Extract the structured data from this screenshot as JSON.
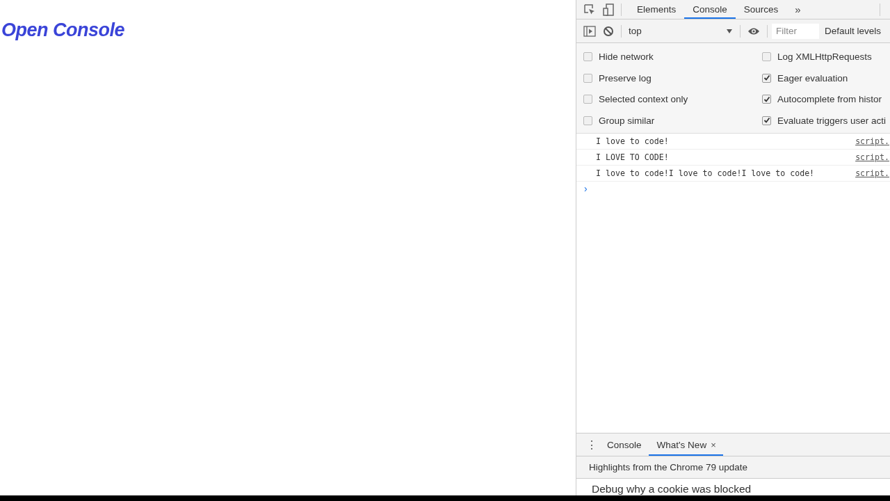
{
  "page": {
    "heading": "Open Console"
  },
  "devtools": {
    "tabs": [
      {
        "label": "Elements",
        "selected": false
      },
      {
        "label": "Console",
        "selected": true
      },
      {
        "label": "Sources",
        "selected": false
      }
    ],
    "more_tabs": "»",
    "context": "top",
    "filter": {
      "placeholder": "Filter"
    },
    "levels": "Default levels",
    "settings": [
      {
        "label": "Hide network",
        "checked": false
      },
      {
        "label": "Log XMLHttpRequests",
        "checked": false
      },
      {
        "label": "Preserve log",
        "checked": false
      },
      {
        "label": "Eager evaluation",
        "checked": true
      },
      {
        "label": "Selected context only",
        "checked": false
      },
      {
        "label": "Autocomplete from histor",
        "checked": true
      },
      {
        "label": "Group similar",
        "checked": false
      },
      {
        "label": "Evaluate triggers user acti",
        "checked": true
      }
    ],
    "messages": [
      {
        "text": "I love to code!",
        "source": "script."
      },
      {
        "text": "I LOVE TO CODE!",
        "source": "script."
      },
      {
        "text": "I love to code!I love to code!I love to code!",
        "source": "script."
      }
    ],
    "prompt": "›",
    "drawer": {
      "menu": "⋮",
      "tabs": [
        {
          "label": "Console",
          "selected": false,
          "closable": false
        },
        {
          "label": "What's New",
          "selected": true,
          "closable": true
        }
      ],
      "close": "×",
      "headline": "Highlights from the Chrome 79 update",
      "item": "Debug why a cookie was blocked"
    }
  }
}
